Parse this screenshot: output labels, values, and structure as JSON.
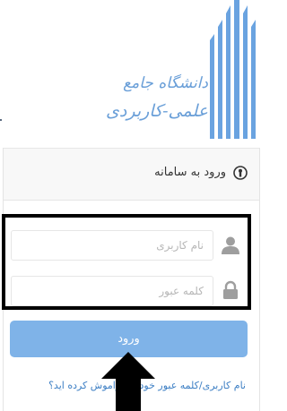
{
  "logo": {
    "line1": "دانشگاه جامع",
    "line2": "علمی-کاربردی"
  },
  "panel": {
    "title": "ورود به سامانه",
    "icon": "info-circle-icon"
  },
  "form": {
    "username_placeholder": "نام کاربری",
    "password_placeholder": "کلمه عبور",
    "username_icon": "user-icon",
    "password_icon": "lock-icon",
    "submit_label": "ورود",
    "forgot_link": "نام کاربری/کلمه عبور خود را فراموش کرده اید؟"
  },
  "colors": {
    "accent": "#7fb3e8",
    "link": "#3d7fc4",
    "logo": "#6a9fd8"
  }
}
